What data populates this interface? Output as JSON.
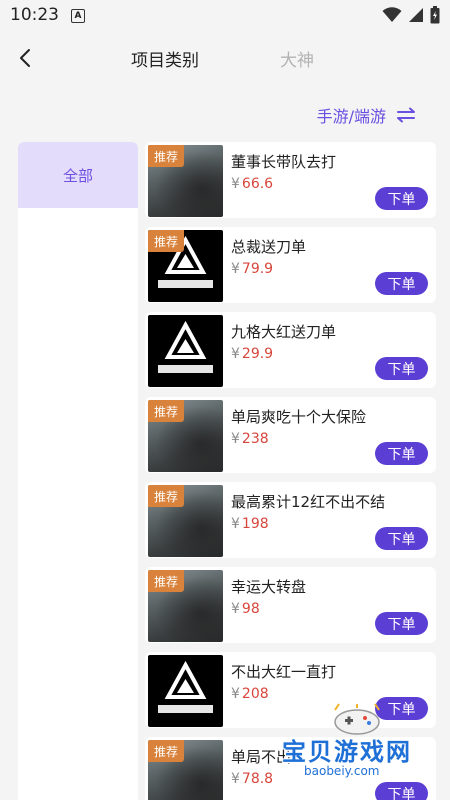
{
  "status_bar": {
    "time": "10:23",
    "notification_icon": "A"
  },
  "nav": {
    "tab_active": "项目类别",
    "tab_inactive": "大神"
  },
  "game_toggle": {
    "label": "手游/端游",
    "icon": "swap-icon"
  },
  "categories": [
    {
      "label": "全部"
    }
  ],
  "items": [
    {
      "title": "董事长带队去打",
      "currency": "¥",
      "price": "66.6",
      "badge": "推荐",
      "thumb": "scene",
      "order_label": "下单"
    },
    {
      "title": "总裁送刀单",
      "currency": "¥",
      "price": "79.9",
      "badge": "推荐",
      "thumb": "logo",
      "order_label": "下单"
    },
    {
      "title": "九格大红送刀单",
      "currency": "¥",
      "price": "29.9",
      "badge": "",
      "thumb": "logo",
      "order_label": "下单"
    },
    {
      "title": "单局爽吃十个大保险",
      "currency": "¥",
      "price": "238",
      "badge": "推荐",
      "thumb": "scene",
      "order_label": "下单"
    },
    {
      "title": "最高累计12红不出不结",
      "currency": "¥",
      "price": "198",
      "badge": "推荐",
      "thumb": "scene",
      "order_label": "下单"
    },
    {
      "title": "幸运大转盘",
      "currency": "¥",
      "price": "98",
      "badge": "推荐",
      "thumb": "scene",
      "order_label": "下单"
    },
    {
      "title": "不出大红一直打",
      "currency": "¥",
      "price": "208",
      "badge": "",
      "thumb": "logo",
      "order_label": "下单"
    },
    {
      "title": "单局不出",
      "currency": "¥",
      "price": "78.8",
      "badge": "推荐",
      "thumb": "scene",
      "order_label": "下单"
    }
  ],
  "watermark": {
    "text": "宝贝游戏网",
    "url": "baobeiy.com"
  },
  "colors": {
    "accent": "#5b3fd4",
    "accent_text": "#6a4fe0",
    "price": "#d7463c",
    "badge": "#d9823b",
    "category_bg": "#e4dcfb"
  }
}
